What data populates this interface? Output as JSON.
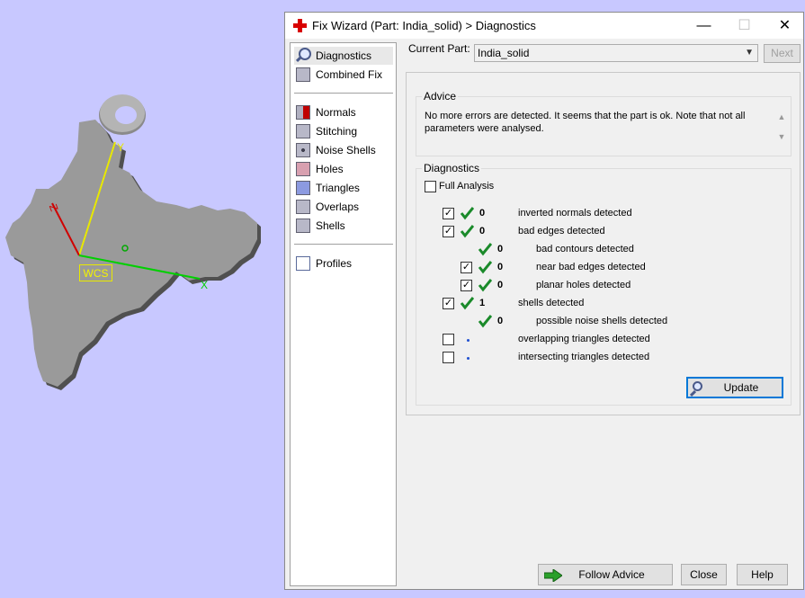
{
  "viewport": {
    "wcs_label": "WCS",
    "axis_x": "X",
    "axis_y": "Y",
    "axis_z": "Z"
  },
  "window": {
    "title": "Fix Wizard (Part: India_solid) > Diagnostics",
    "minimize": "—",
    "maximize": "☐",
    "close": "✕"
  },
  "sidebar": {
    "items": [
      {
        "label": "Diagnostics",
        "icon": "magnifier-icon"
      },
      {
        "label": "Combined Fix",
        "icon": "cube-icon"
      },
      {
        "label": "Normals",
        "icon": "normals-cube-icon"
      },
      {
        "label": "Stitching",
        "icon": "stitching-cube-icon"
      },
      {
        "label": "Noise Shells",
        "icon": "noise-shells-cube-icon"
      },
      {
        "label": "Holes",
        "icon": "holes-cube-icon"
      },
      {
        "label": "Triangles",
        "icon": "triangles-cube-icon"
      },
      {
        "label": "Overlaps",
        "icon": "overlaps-cube-icon"
      },
      {
        "label": "Shells",
        "icon": "shells-cube-icon"
      },
      {
        "label": "Profiles",
        "icon": "document-icon"
      }
    ]
  },
  "current_part": {
    "label": "Current Part:",
    "value": "India_solid",
    "next_label": "Next"
  },
  "advice": {
    "title": "Advice",
    "text": "No more errors are detected. It seems that the part is ok. Note that not all parameters were analysed."
  },
  "diagnostics": {
    "title": "Diagnostics",
    "full_analysis_label": "Full Analysis",
    "full_analysis_checked": false,
    "rows": [
      {
        "label": "inverted normals detected",
        "count": "0",
        "checked": true,
        "has_checkbox": true,
        "status": "ok"
      },
      {
        "label": "bad edges detected",
        "count": "0",
        "checked": true,
        "has_checkbox": true,
        "status": "ok"
      },
      {
        "label": "bad contours detected",
        "count": "0",
        "checked": false,
        "has_checkbox": false,
        "status": "ok"
      },
      {
        "label": "near bad edges detected",
        "count": "0",
        "checked": true,
        "has_checkbox": true,
        "status": "ok"
      },
      {
        "label": "planar holes detected",
        "count": "0",
        "checked": true,
        "has_checkbox": true,
        "status": "ok"
      },
      {
        "label": "shells detected",
        "count": "1",
        "checked": true,
        "has_checkbox": true,
        "status": "ok"
      },
      {
        "label": "possible noise shells detected",
        "count": "0",
        "checked": false,
        "has_checkbox": false,
        "status": "ok"
      },
      {
        "label": "overlapping triangles detected",
        "count": "",
        "checked": false,
        "has_checkbox": true,
        "status": "not-analysed"
      },
      {
        "label": "intersecting triangles detected",
        "count": "",
        "checked": false,
        "has_checkbox": true,
        "status": "not-analysed"
      }
    ],
    "update_label": "Update"
  },
  "footer": {
    "follow_advice_label": "Follow Advice",
    "close_label": "Close",
    "help_label": "Help"
  },
  "colors": {
    "viewport_bg": "#c8c8ff",
    "check_green": "#1a8a2a",
    "accent": "#0078d7"
  }
}
